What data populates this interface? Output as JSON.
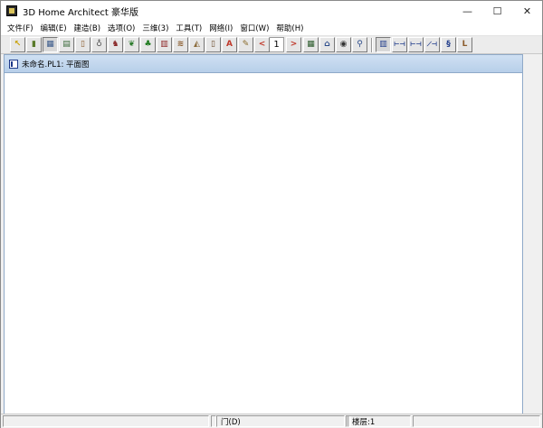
{
  "window": {
    "title": "3D Home Architect 豪华版",
    "minimize": "—",
    "maximize": "☐",
    "close": "✕"
  },
  "menu": [
    "文件(F)",
    "编辑(E)",
    "建造(B)",
    "选项(O)",
    "三维(3)",
    "工具(T)",
    "网络(I)",
    "窗口(W)",
    "帮助(H)"
  ],
  "toolbar": {
    "floor_number": "1",
    "prev_floor": "<",
    "next_floor": ">",
    "tools": [
      {
        "name": "select-arrow-icon",
        "glyph": "↖",
        "color": "#c9a000"
      },
      {
        "name": "wall-tool-icon",
        "glyph": "▮",
        "color": "#5a7a2a"
      },
      {
        "name": "room-tool-icon",
        "glyph": "▦",
        "color": "#3a5a8a"
      },
      {
        "name": "cabinet-tool-icon",
        "glyph": "▤",
        "color": "#3a6a3a"
      },
      {
        "name": "door-tool-icon",
        "glyph": "▯",
        "color": "#8a5a2a"
      },
      {
        "name": "fixture-tool-icon",
        "glyph": "♁",
        "color": "#555555"
      },
      {
        "name": "furniture-tool-icon",
        "glyph": "♞",
        "color": "#8a2a2a"
      },
      {
        "name": "landscape-tool-icon",
        "glyph": "❦",
        "color": "#2a7a2a"
      },
      {
        "name": "tree-tool-icon",
        "glyph": "♣",
        "color": "#1e7a1e"
      },
      {
        "name": "fireplace-tool-icon",
        "glyph": "▥",
        "color": "#8a1e1e"
      },
      {
        "name": "stairs-tool-icon",
        "glyph": "≋",
        "color": "#8a5a2a"
      },
      {
        "name": "roof-tool-icon",
        "glyph": "◭",
        "color": "#8a6a3a"
      },
      {
        "name": "column-tool-icon",
        "glyph": "▯",
        "color": "#6a4a2a"
      },
      {
        "name": "text-tool-icon",
        "glyph": "A",
        "color": "#c0392b"
      },
      {
        "name": "dimension-tool-icon",
        "glyph": "✎",
        "color": "#8a6a2a"
      }
    ],
    "view_tools": [
      {
        "name": "plan-view-icon",
        "glyph": "▦",
        "color": "#2a5a2a"
      },
      {
        "name": "elevation-view-icon",
        "glyph": "⌂",
        "color": "#2a4a8a"
      },
      {
        "name": "camera-view-icon",
        "glyph": "◉",
        "color": "#333333"
      },
      {
        "name": "zoom-icon",
        "glyph": "⚲",
        "color": "#2a4a8a"
      }
    ],
    "mode_tools": [
      {
        "name": "plan-mode-icon",
        "glyph": "▥",
        "color": "#1e3a8a"
      },
      {
        "name": "wall-straight-icon",
        "glyph": "⊢⊣",
        "color": "#1e3a8a"
      },
      {
        "name": "wall-dimension-icon",
        "glyph": "⊢⊣",
        "color": "#1e3a8a"
      },
      {
        "name": "wall-angled-icon",
        "glyph": "⟋⊣",
        "color": "#1e3a8a"
      },
      {
        "name": "wall-curved-icon",
        "glyph": "§",
        "color": "#1e3a8a"
      },
      {
        "name": "wall-l-shape-icon",
        "glyph": "L",
        "color": "#8a5a2a"
      }
    ]
  },
  "document": {
    "title": "未命名.PL1: 平面图"
  },
  "status": {
    "pane_1": "",
    "pane_2": "",
    "tool": "门(D)",
    "pane_4": "",
    "floor": "楼层:1",
    "pane_6": ""
  }
}
